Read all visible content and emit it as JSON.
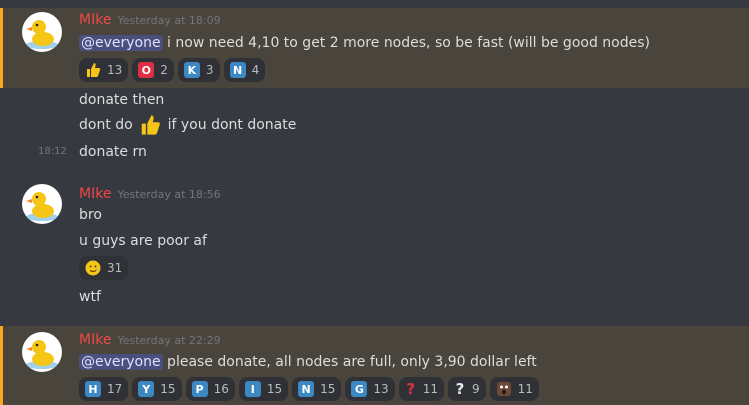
{
  "messages": [
    {
      "username": "MIke",
      "timestamp": "Yesterday at 18:09",
      "mention": "@everyone",
      "text": " i now need 4,10 to get 2 more nodes, so be fast (will be good nodes)",
      "reactions": [
        {
          "icon": "thumbs-up",
          "count": "13"
        },
        {
          "letter": "O",
          "color": "red",
          "count": "2"
        },
        {
          "letter": "K",
          "color": "blue",
          "count": "3"
        },
        {
          "letter": "N",
          "color": "blue",
          "count": "4"
        }
      ]
    },
    {
      "text": "donate then"
    },
    {
      "text_before": "dont do ",
      "icon": "thumbs-up",
      "text_after": " if you dont donate"
    },
    {
      "side_time": "18:12",
      "text": "donate rn"
    },
    {
      "username": "MIke",
      "timestamp": "Yesterday at 18:56",
      "text": "bro"
    },
    {
      "text": "u guys are poor af",
      "reactions": [
        {
          "icon": "smiling-tear-face",
          "count": "31"
        }
      ]
    },
    {
      "text": "wtf"
    },
    {
      "username": "MIke",
      "timestamp": "Yesterday at 22:29",
      "mention": "@everyone",
      "text": " please donate, all  nodes are full, only 3,90 dollar left",
      "reactions": [
        {
          "letter": "H",
          "color": "blue",
          "count": "17"
        },
        {
          "letter": "Y",
          "color": "blue",
          "count": "15"
        },
        {
          "letter": "P",
          "color": "blue",
          "count": "16"
        },
        {
          "letter": "I",
          "color": "blue",
          "count": "15"
        },
        {
          "letter": "N",
          "color": "blue",
          "count": "15"
        },
        {
          "letter": "G",
          "color": "blue",
          "count": "13"
        },
        {
          "icon": "red-question-mark",
          "count": "11"
        },
        {
          "icon": "white-question-mark",
          "count": "9"
        },
        {
          "icon": "wow-face",
          "count": "11"
        }
      ]
    }
  ],
  "colors": {
    "background": "#36393f",
    "highlight": "#49443c",
    "highlight_border": "#faa81a",
    "username": "#f04747",
    "mention_bg": "#4b4f7e",
    "reaction_bg": "#2f3136"
  }
}
